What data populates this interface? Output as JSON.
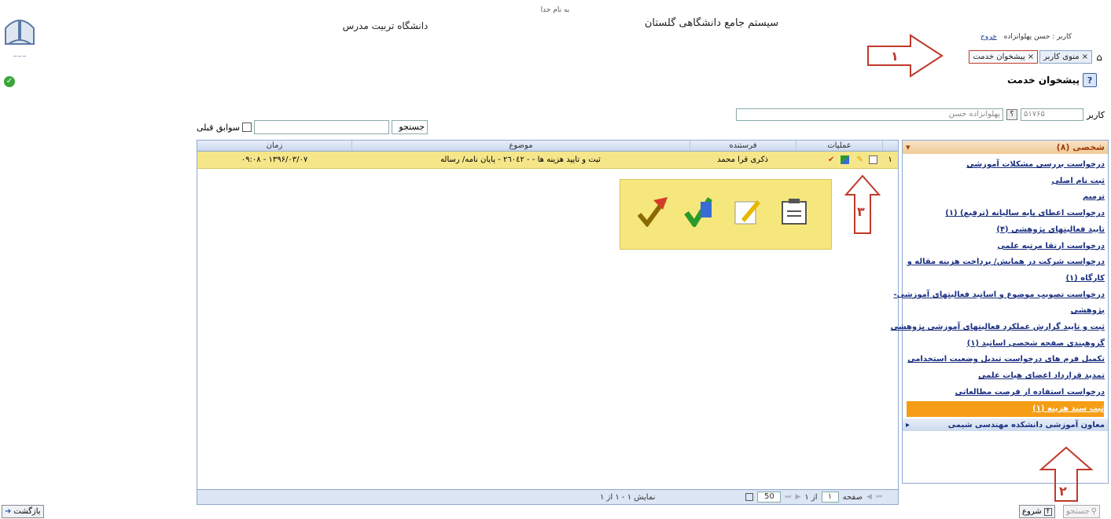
{
  "header": {
    "basmala": "به نام خدا",
    "system_title": "سیستم جامع دانشگاهی گلستان",
    "university": "دانشگاه تربیت مدرس",
    "user_prefix": "کاربر : حسن پهلوانزاده",
    "logout": "خروج"
  },
  "tabs": [
    {
      "label": "منوی کاربر",
      "close": "×"
    },
    {
      "label": "پیشخوان خدمت",
      "close": "×"
    }
  ],
  "page_title": "پیشخوان خدمت",
  "user_row": {
    "label": "کاربر",
    "code": "۵۱۷۶۵",
    "q": "؟",
    "name": "پهلوانزاده حسن"
  },
  "search": {
    "label": "جستجو",
    "value": "",
    "history_label": "سوابق قبلی"
  },
  "grid": {
    "headers": {
      "ops": "عملیات",
      "sender": "فرستنده",
      "subject": "موضوع",
      "time": "زمان"
    },
    "rows": [
      {
        "num": "۱",
        "sender": "ذکری قرا محمد",
        "subject": "ثبت و تایید هزینه ها - - ٢٦٠٤٢ - پایان نامه/ رساله",
        "time": "۱۳۹۶/۰۳/۰۷ - ۰۹:۰۸"
      }
    ],
    "footer": {
      "page_label": "صفحه",
      "page": "۱",
      "of": "از ۱",
      "page_size": "50",
      "display": "نمایش ۱ - ۱ از ۱"
    }
  },
  "sidebar": {
    "header": "شخصی (۸)",
    "items": [
      "درخواست بررسی مشکلات آموزشی",
      "ثبت نام اصلی",
      "ترمیم",
      "درخواست اعطای پایه سالیانه (ترفیع) (۱)",
      "تایید فعالیتهای پژوهشی (۴)",
      "درخواست ارتقا مرتبه علمی",
      "درخواست شرکت در همایش/ پرداخت هزینه مقاله و",
      "کارگاه (۱)",
      "درخواست تصویب موضوع و اساتید فعالیتهای آموزشی-",
      "پژوهشی",
      "ثبت و تایید گزارش عملکرد فعالیتهای آموزشی پژوهشی",
      "گروهبندی صفحه شخصی اساتید (۱)",
      "تکمیل فرم های درخواست تبدیل وضعیت استخدامی",
      "تمدید قرارداد اعضای هیات علمی",
      "درخواست استفاده از فرصت مطالعاتی",
      "ثبت سند هزینه (۱)"
    ],
    "footer": "معاون آموزشی دانشکده مهندسی شیمی"
  },
  "annotations": {
    "a1": "۱",
    "a2": "۲",
    "a3": "۳"
  },
  "bottom": {
    "back": "بازگشت",
    "start": "شروع",
    "search": "جستجو"
  },
  "colors": {
    "row_highlight": "#f6e68a",
    "selected_item": "#f59d14",
    "annotation": "#c0392b"
  }
}
